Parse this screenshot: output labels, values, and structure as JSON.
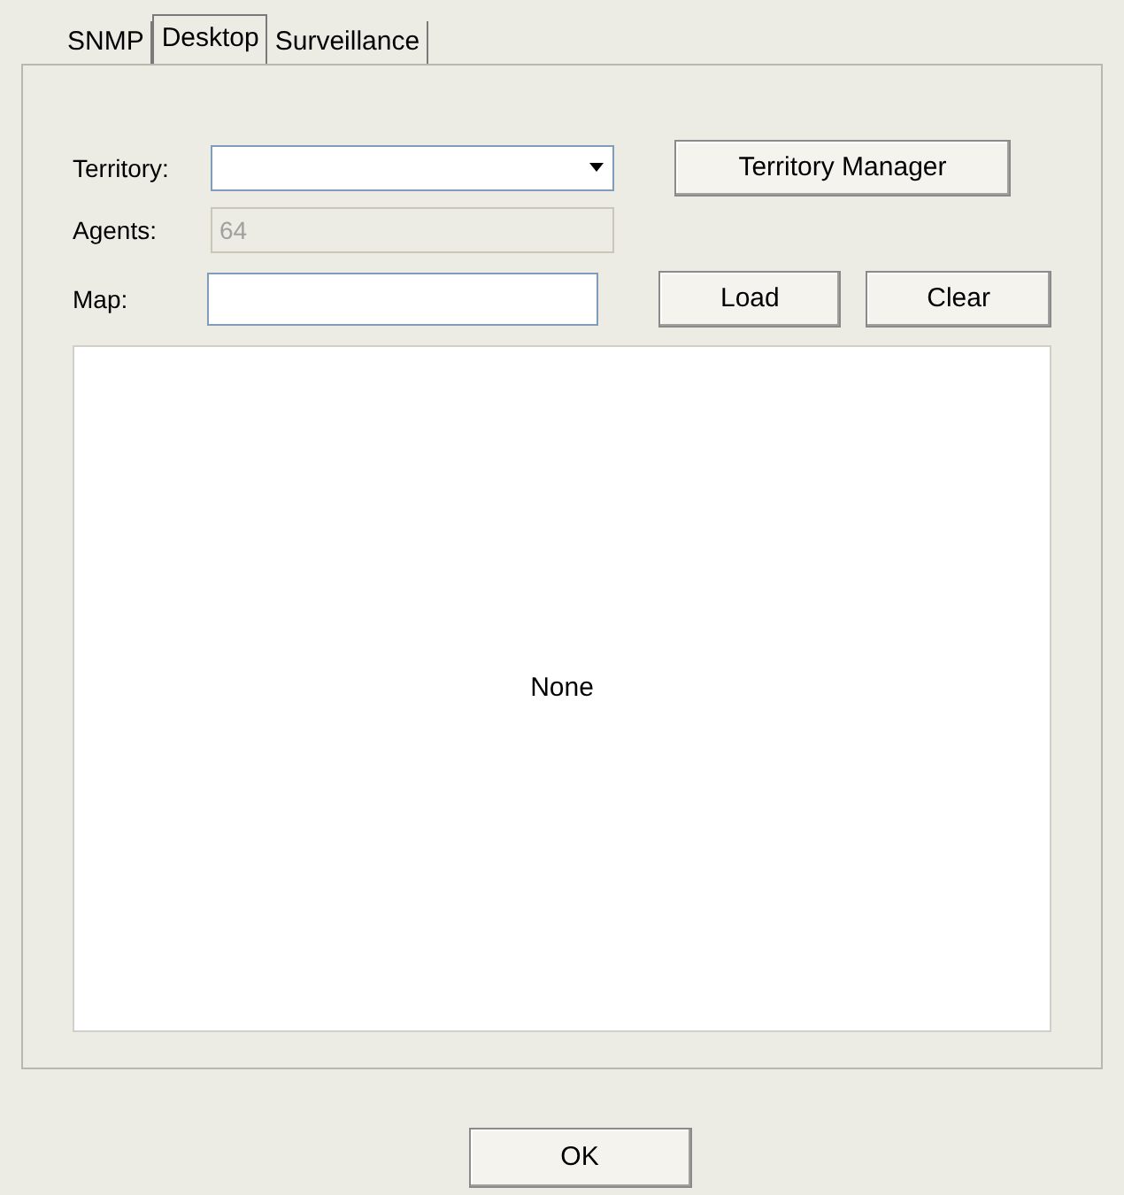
{
  "tabs": [
    {
      "label": "SNMP",
      "selected": false
    },
    {
      "label": "Desktop",
      "selected": true
    },
    {
      "label": "Surveillance",
      "selected": false
    }
  ],
  "territory": {
    "label": "Territory:"
  },
  "agents": {
    "label": "Agents:",
    "value": "64",
    "disabled": true
  },
  "map": {
    "label": "Map:"
  },
  "buttons": {
    "territory_manager": "Territory Manager",
    "load": "Load",
    "clear": "Clear"
  },
  "preview": {
    "text": "None"
  },
  "ok_button": "OK"
}
